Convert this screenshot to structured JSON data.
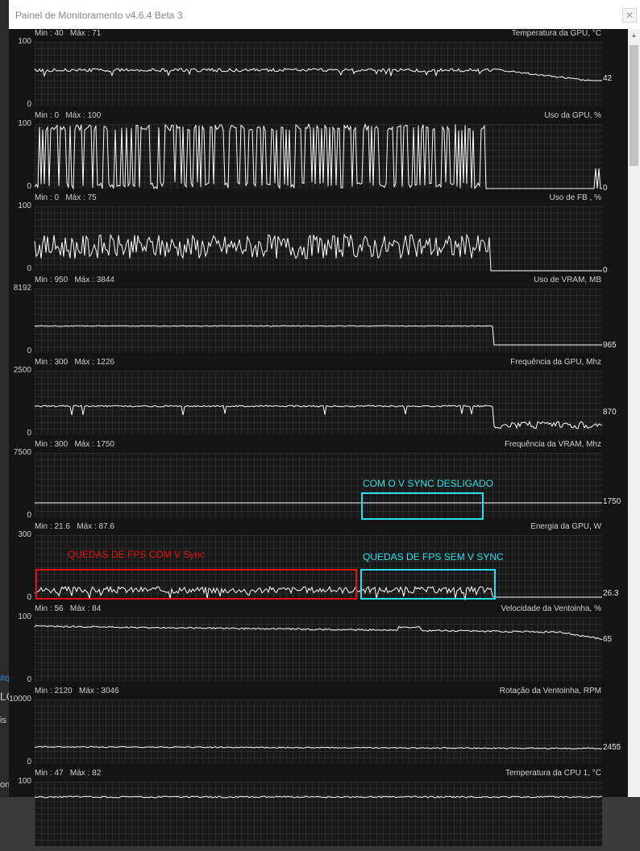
{
  "window": {
    "title": "Painel de Monitoramento v4.6.4 Beta 3",
    "close_glyph": "✕"
  },
  "background_fragments": {
    "f1": "#q",
    "f2": "LC",
    "f3": "is",
    "f4": "on"
  },
  "colors": {
    "line": "#ffffff",
    "red_annotation": "#e01010",
    "cyan_annotation": "#29e0e8"
  },
  "graphs": [
    {
      "minmax": "Min : 40   Máx : 71",
      "title": "Temperatura da GPU, °C",
      "ymax": "100",
      "ymin": "0",
      "current": "42",
      "current_value": 42,
      "scale_max": 100
    },
    {
      "minmax": "Min : 0   Máx : 100",
      "title": "Uso da GPU, %",
      "ymax": "100",
      "ymin": "0",
      "current": "0",
      "current_value": 0,
      "scale_max": 100
    },
    {
      "minmax": "Min : 0   Máx : 75",
      "title": "Uso de FB , %",
      "ymax": "100",
      "ymin": "0",
      "current": "0",
      "current_value": 0,
      "scale_max": 100
    },
    {
      "minmax": "Min : 950   Máx : 3844",
      "title": "Uso de VRAM, MB",
      "ymax": "8192",
      "ymin": "0",
      "current": "965",
      "current_value": 965,
      "scale_max": 8192
    },
    {
      "minmax": "Min : 300   Máx : 1226",
      "title": "Frequência da GPU, Mhz",
      "ymax": "2500",
      "ymin": "0",
      "current": "870",
      "current_value": 870,
      "scale_max": 2500
    },
    {
      "minmax": "Min : 300   Máx : 1750",
      "title": "Frequência da VRAM, Mhz",
      "ymax": "7500",
      "ymin": "0",
      "current": "1750",
      "current_value": 1750,
      "scale_max": 7500
    },
    {
      "minmax": "Min : 21.6   Máx : 87.6",
      "title": "Energia da GPU, W",
      "ymax": "300",
      "ymin": "0",
      "current": "26.3",
      "current_value": 26.3,
      "scale_max": 300
    },
    {
      "minmax": "Min : 56   Máx : 84",
      "title": "Velocidade da Ventoinha, %",
      "ymax": "100",
      "ymin": "0",
      "current": "65",
      "current_value": 65,
      "scale_max": 100
    },
    {
      "minmax": "Min : 2120   Máx : 3046",
      "title": "Rotação da Ventoinha, RPM",
      "ymax": "10000",
      "ymin": "0",
      "current": "2455",
      "current_value": 2455,
      "scale_max": 10000
    },
    {
      "minmax": "Min : 47   Máx : 82",
      "title": "Temperatura da CPU 1, °C",
      "ymax": "100",
      "ymin": "",
      "current": "",
      "current_value": null,
      "scale_max": 100
    }
  ],
  "annotations": {
    "vsync_off": "COM O V SYNC DESLIGADO",
    "drops_with_vsync": "QUEDAS DE FPS COM V Sync",
    "drops_without_vsync": "QUEDAS DE FPS SEM V SYNC"
  }
}
